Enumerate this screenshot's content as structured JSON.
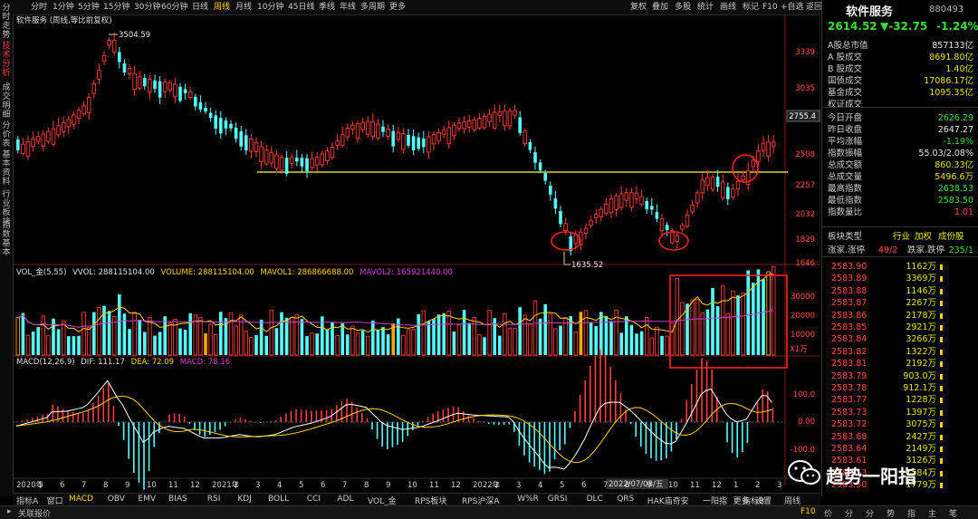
{
  "left_tabs": [
    {
      "label": "分时走势",
      "active": false
    },
    {
      "label": "技术分析",
      "active": true
    },
    {
      "label": "成交明细",
      "active": false
    },
    {
      "label": "分价表",
      "active": false
    },
    {
      "label": "基本资料",
      "active": false
    },
    {
      "label": "行业板块",
      "active": false
    },
    {
      "label": "指数基本",
      "active": false
    }
  ],
  "toolbar": {
    "periods": [
      "分时",
      "1分钟",
      "5分钟",
      "15分钟",
      "30分钟",
      "60分钟",
      "日线",
      "周线",
      "月线",
      "10分钟",
      "45日线",
      "季线",
      "年线",
      "多周期",
      "更多"
    ],
    "active_period": "周线",
    "right": [
      "复权",
      "叠加",
      "多股",
      "统计",
      "画线",
      "标记",
      "F10",
      "+自选",
      "返回"
    ]
  },
  "main_chart": {
    "legend": "软件服务 (周线,等比前复权)",
    "high_label": "3504.59",
    "low_label": "1635.52",
    "current_price_tag": "2755.4",
    "y_ticks": [
      "3339",
      "3035",
      "2755.4",
      "2508",
      "2257",
      "2032",
      "1829",
      "1646"
    ]
  },
  "volume": {
    "legend": "VOL_金(5,55)",
    "vvol": "VVOL: 288115104.00",
    "volume": "VOLUME: 288115104.00",
    "mavol1": "MAVOL1: 286866688.00",
    "mavol2": "MAVOL2: 165921440.00",
    "y_ticks": [
      "30000",
      "20000",
      "10000"
    ],
    "unit": "X1万",
    "date_tag": "2022/07/08/五"
  },
  "macd": {
    "legend": "MACD(12,26,9)",
    "dif": "DIF: 111.17",
    "dea": "DEA: 72.09",
    "macd": "MACD: 78.16",
    "y_ticks": [
      "100.0",
      "0.00",
      "-100.0"
    ]
  },
  "x_axis": [
    "2020年",
    "5",
    "6",
    "7",
    "8",
    "9",
    "10",
    "11",
    "12",
    "2021年",
    "2",
    "3",
    "4",
    "5",
    "6",
    "7",
    "8",
    "9",
    "10",
    "11",
    "12",
    "2022年",
    "2",
    "3",
    "4",
    "5",
    "6",
    "7",
    "8",
    "9",
    "10",
    "11",
    "12",
    "1",
    "2",
    "3"
  ],
  "panel": {
    "title": "软件服务",
    "code": "880493",
    "price": "2614.52",
    "change": "▼-32.75",
    "pct": "-1.24%",
    "stats": [
      {
        "k": "A股总市值",
        "v": "857133亿",
        "c": "#e8e8e8"
      },
      {
        "k": "A 股成交",
        "v": "8691.80亿",
        "c": "#e6e600"
      },
      {
        "k": "B 股成交",
        "v": "1.40亿",
        "c": "#e6e600"
      },
      {
        "k": "国债成交",
        "v": "17086.17亿",
        "c": "#e6e600"
      },
      {
        "k": "基金成交",
        "v": "1095.35亿",
        "c": "#e6e600"
      },
      {
        "k": "权证成交",
        "v": "",
        "c": "#e6e600"
      },
      {
        "k": "今日开盘",
        "v": "2626.29",
        "c": "#3ddc3d"
      },
      {
        "k": "昨日收盘",
        "v": "2647.27",
        "c": "#e8e8e8"
      },
      {
        "k": "平均涨幅",
        "v": "-1.19%",
        "c": "#3ddc3d"
      },
      {
        "k": "指数振幅",
        "v": "55.03/2.08%",
        "c": "#e8e8e8"
      },
      {
        "k": "总成交额",
        "v": "860.33亿",
        "c": "#e6e600"
      },
      {
        "k": "总成交量",
        "v": "5496.6万",
        "c": "#e6e600"
      },
      {
        "k": "最高指数",
        "v": "2638.53",
        "c": "#3ddc3d"
      },
      {
        "k": "最低指数",
        "v": "2583.50",
        "c": "#3ddc3d"
      },
      {
        "k": "指数量比",
        "v": "1.01",
        "c": "#ff4b4b"
      }
    ],
    "sector_type": "板块类型",
    "sector_links": [
      "行业",
      "加权",
      "成份股"
    ],
    "rise_label": "涨家.涨停",
    "rise_val": "49/2",
    "fall_label": "跌家.跌停",
    "fall_val": "235/1",
    "ticks": [
      {
        "p": "2583.90",
        "q": "1162万"
      },
      {
        "p": "2583.89",
        "q": "3369万"
      },
      {
        "p": "2583.88",
        "q": "1146万"
      },
      {
        "p": "2583.87",
        "q": "2267万"
      },
      {
        "p": "2583.86",
        "q": "2178万"
      },
      {
        "p": "2583.85",
        "q": "2921万"
      },
      {
        "p": "2583.84",
        "q": "3266万"
      },
      {
        "p": "2583.82",
        "q": "1322万"
      },
      {
        "p": "2583.81",
        "q": "2192万"
      },
      {
        "p": "2583.79",
        "q": "903.0万"
      },
      {
        "p": "2583.78",
        "q": "912.1万"
      },
      {
        "p": "2583.77",
        "q": "1228万"
      },
      {
        "p": "2583.73",
        "q": "1397万"
      },
      {
        "p": "2583.72",
        "q": "3075万"
      },
      {
        "p": "2583.68",
        "q": "2427万"
      },
      {
        "p": "2583.64",
        "q": "2149万"
      },
      {
        "p": "2583.61",
        "q": "3126万"
      },
      {
        "p": "2583.53",
        "q": "1584万"
      },
      {
        "p": "2583.50",
        "q": "1779万"
      }
    ]
  },
  "bottom_tabs": [
    "指标A",
    "窗口",
    "MACD",
    "OBV",
    "EMV",
    "BIAS",
    "RSI",
    "KDJ",
    "BOLL",
    "CCI",
    "ADL",
    "VOL_金",
    "RPS板块",
    "RPS沪深A",
    "W%R",
    "GRSI",
    "DLC",
    "QRS",
    "HAK庙奇安",
    "一阳指",
    "更多",
    "设置"
  ],
  "bottom_active": "MACD",
  "bottom_right": [
    "指标B",
    "周线"
  ],
  "status": {
    "left": "关联报价",
    "f10": "F10",
    "icons": [
      "价",
      "分",
      "分",
      "势",
      "指",
      "主",
      "笔"
    ]
  },
  "watermark": "趋势一阳指",
  "accent": {
    "up": "#ff3b3b",
    "down": "#54ffff",
    "support": "#ffff3b",
    "circle": "#ff2020"
  }
}
